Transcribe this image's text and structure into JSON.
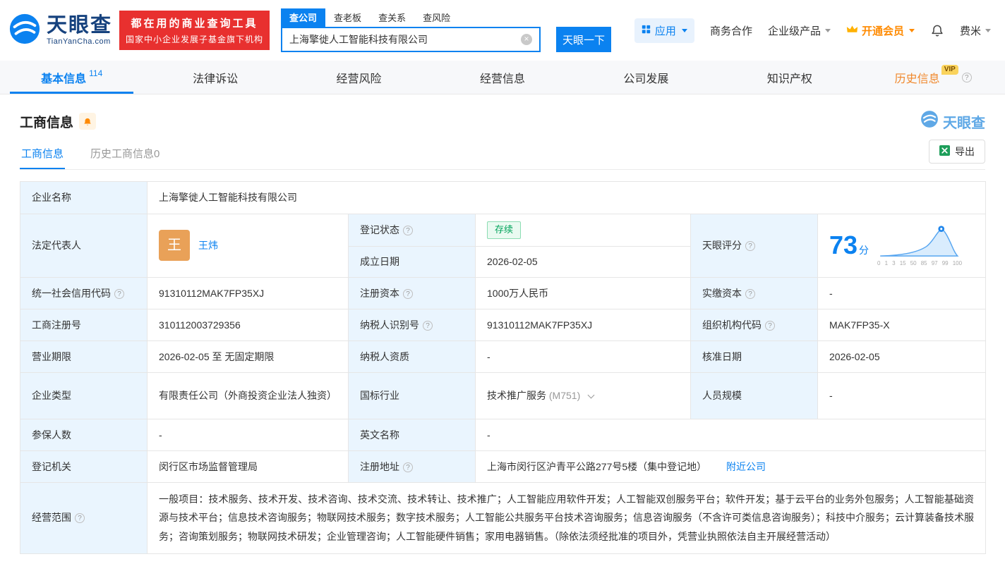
{
  "icons": {
    "clear": "×",
    "help": "?"
  },
  "header": {
    "logo": {
      "cn": "天眼查",
      "en": "TianYanCha.com"
    },
    "banner": {
      "line1": "都在用的商业查询工具",
      "line2": "国家中小企业发展子基金旗下机构"
    },
    "search": {
      "tabs": [
        {
          "label": "查公司"
        },
        {
          "label": "查老板"
        },
        {
          "label": "查关系"
        },
        {
          "label": "查风险"
        }
      ],
      "value": "上海擎徙人工智能科技有限公司",
      "button": "天眼一下"
    },
    "right": {
      "apps": "应用",
      "cooperation": "商务合作",
      "enterprise": "企业级产品",
      "vip": "开通会员",
      "user": "费米"
    }
  },
  "nav_tabs": [
    {
      "label": "基本信息",
      "badge": "114"
    },
    {
      "label": "法律诉讼"
    },
    {
      "label": "经营风险"
    },
    {
      "label": "经营信息"
    },
    {
      "label": "公司发展"
    },
    {
      "label": "知识产权"
    },
    {
      "label": "历史信息",
      "vip": "VIP"
    }
  ],
  "section": {
    "title": "工商信息",
    "watermark": "天眼查",
    "subtabs": [
      {
        "label": "工商信息"
      },
      {
        "label": "历史工商信息",
        "count": "0"
      }
    ],
    "export": "导出"
  },
  "info": {
    "company_name_label": "企业名称",
    "company_name": "上海擎徙人工智能科技有限公司",
    "legal_rep_label": "法定代表人",
    "legal_rep_avatar": "王",
    "legal_rep_name": "王炜",
    "reg_status_label": "登记状态",
    "reg_status": "存续",
    "establish_label": "成立日期",
    "establish_date": "2026-02-05",
    "score_label": "天眼评分",
    "credit_code_label": "统一社会信用代码",
    "credit_code": "91310112MAK7FP35XJ",
    "reg_capital_label": "注册资本",
    "reg_capital": "1000万人民币",
    "paid_capital_label": "实缴资本",
    "paid_capital": "-",
    "reg_number_label": "工商注册号",
    "reg_number": "310112003729356",
    "taxpayer_id_label": "纳税人识别号",
    "taxpayer_id": "91310112MAK7FP35XJ",
    "org_code_label": "组织机构代码",
    "org_code": "MAK7FP35-X",
    "business_term_label": "营业期限",
    "business_term": "2026-02-05 至 无固定期限",
    "taxpayer_quality_label": "纳税人资质",
    "taxpayer_quality": "-",
    "approval_date_label": "核准日期",
    "approval_date": "2026-02-05",
    "company_type_label": "企业类型",
    "company_type": "有限责任公司（外商投资企业法人独资）",
    "industry_label": "国标行业",
    "industry": "技术推广服务",
    "industry_code": "(M751)",
    "staff_size_label": "人员规模",
    "staff_size": "-",
    "insured_label": "参保人数",
    "insured": "-",
    "english_name_label": "英文名称",
    "english_name": "-",
    "reg_authority_label": "登记机关",
    "reg_authority": "闵行区市场监督管理局",
    "address_label": "注册地址",
    "address": "上海市闵行区沪青平公路277号5楼（集中登记地）",
    "nearby_link": "附近公司",
    "business_scope_label": "经营范围",
    "business_scope": "一般项目：技术服务、技术开发、技术咨询、技术交流、技术转让、技术推广；人工智能应用软件开发；人工智能双创服务平台；软件开发；基于云平台的业务外包服务；人工智能基础资源与技术平台；信息技术咨询服务；物联网技术服务；数字技术服务；人工智能公共服务平台技术咨询服务；信息咨询服务（不含许可类信息咨询服务）；科技中介服务；云计算装备技术服务；咨询策划服务；物联网技术研发；企业管理咨询；人工智能硬件销售；家用电器销售。（除依法须经批准的项目外，凭营业执照依法自主开展经营活动）"
  },
  "score": {
    "value": "73",
    "unit": "分",
    "axis": [
      "0",
      "1",
      "3",
      "15",
      "50",
      "85",
      "97",
      "99",
      "100"
    ]
  }
}
